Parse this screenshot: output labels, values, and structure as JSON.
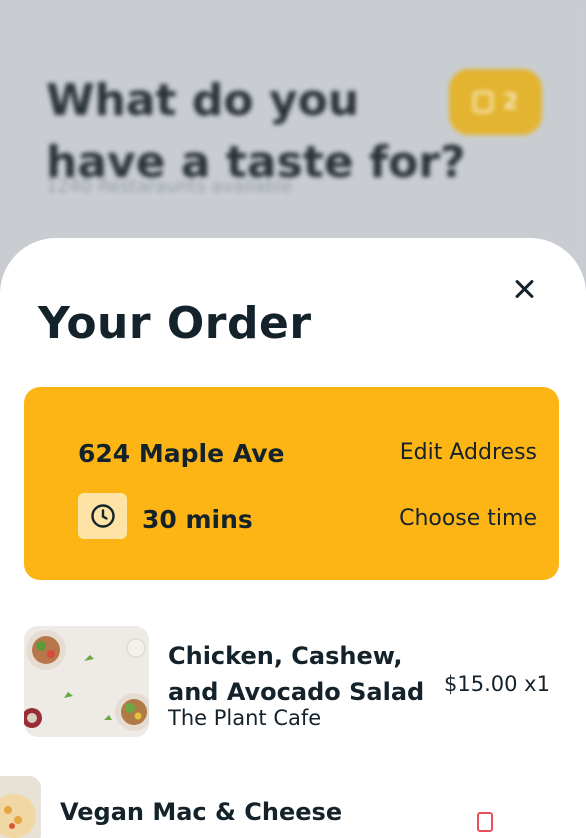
{
  "background": {
    "heading": "What do you have a taste for?",
    "subheading": "1240 Restaraunts available",
    "cart_count": "2",
    "cart_icon": "shopping-bag-icon"
  },
  "sheet": {
    "title": "Your Order",
    "close_icon": "close-icon",
    "delivery": {
      "address": "624 Maple Ave",
      "edit_label": "Edit Address",
      "time": "30 mins",
      "time_icon": "clock-icon",
      "choose_label": "Choose time",
      "accent": "#fdb515"
    },
    "items": [
      {
        "name": "Chicken, Cashew, and Avocado Salad",
        "restaurant": "The Plant Cafe",
        "price": "$15.00 x1"
      },
      {
        "name": "Vegan Mac & Cheese",
        "delete_icon": "trash-icon"
      }
    ]
  }
}
